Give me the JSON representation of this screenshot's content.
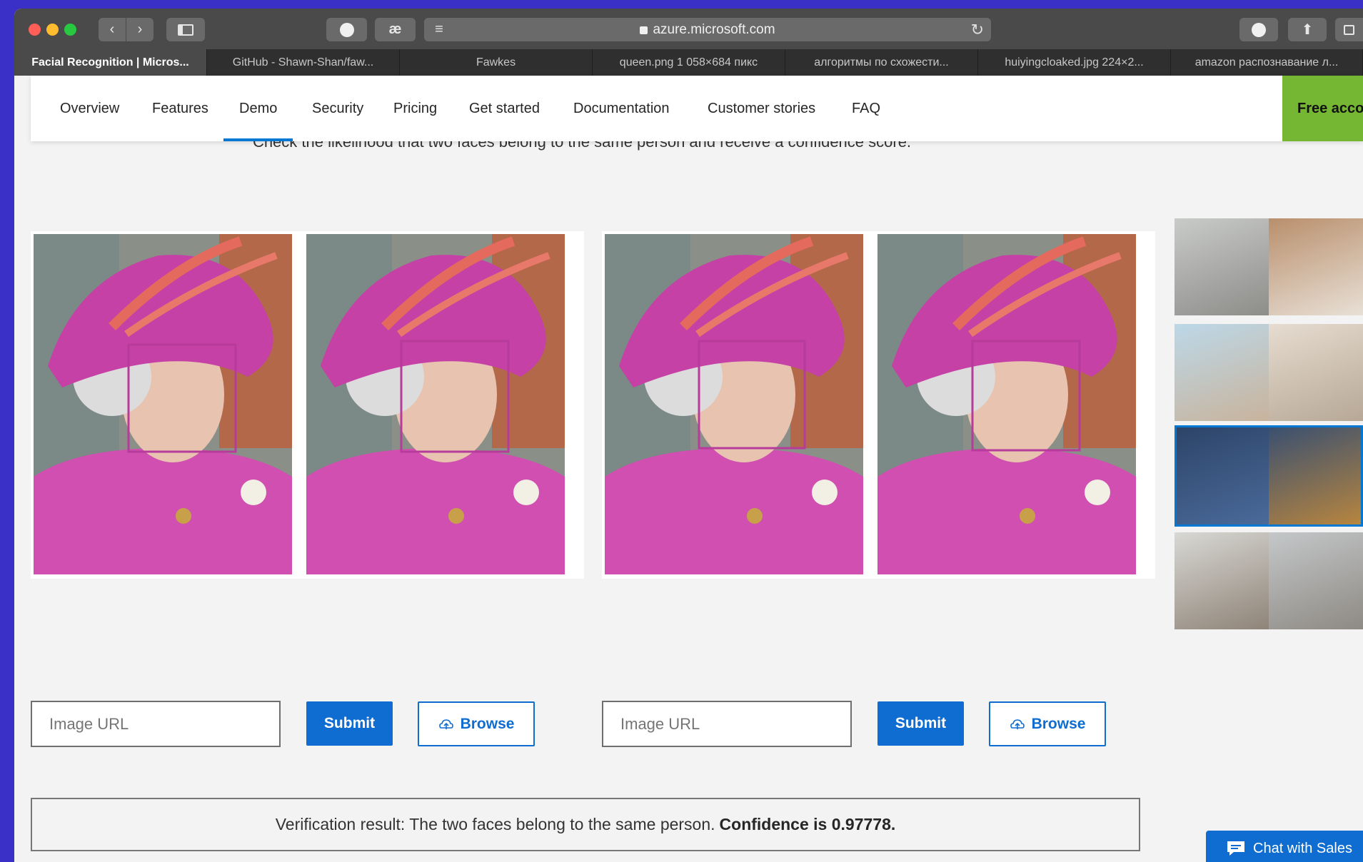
{
  "browser": {
    "url": "azure.microsoft.com",
    "tabs": [
      {
        "label": "Facial Recognition | Micros..."
      },
      {
        "label": "GitHub - Shawn-Shan/faw..."
      },
      {
        "label": "Fawkes"
      },
      {
        "label": "queen.png 1 058×684 пикс"
      },
      {
        "label": "алгоритмы по схожести..."
      },
      {
        "label": "huiyingcloaked.jpg 224×2..."
      },
      {
        "label": "amazon распознавание л..."
      }
    ]
  },
  "nav": {
    "items": [
      {
        "label": "Overview"
      },
      {
        "label": "Features"
      },
      {
        "label": "Demo"
      },
      {
        "label": "Security"
      },
      {
        "label": "Pricing"
      },
      {
        "label": "Get started"
      },
      {
        "label": "Documentation"
      },
      {
        "label": "Customer stories"
      },
      {
        "label": "FAQ"
      }
    ],
    "free_account": "Free account"
  },
  "demo": {
    "subtitle": "Check the likelihood that two faces belong to the same person and receive a confidence score.",
    "left": {
      "placeholder": "Image URL",
      "submit": "Submit",
      "browse": "Browse"
    },
    "right": {
      "placeholder": "Image URL",
      "submit": "Submit",
      "browse": "Browse"
    },
    "result_text": "Verification result: The two faces belong to the same person.",
    "result_bold": "Confidence is 0.97778."
  },
  "chat": {
    "label": "Chat with Sales"
  },
  "colors": {
    "accent": "#0f6cd0",
    "free_account": "#75b732",
    "face_box": "#b63b9a"
  }
}
